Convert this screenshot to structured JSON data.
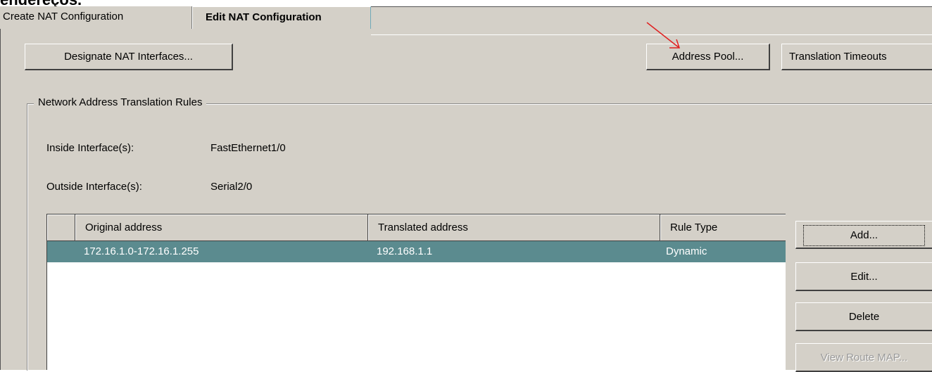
{
  "top_cut_text": "endereços.",
  "tabs": [
    {
      "label": "Create NAT Configuration",
      "active": false
    },
    {
      "label": "Edit NAT Configuration",
      "active": true
    }
  ],
  "toolbar": {
    "designate_label": "Designate NAT Interfaces...",
    "pool_label": "Address Pool...",
    "timeouts_label": "Translation Timeouts"
  },
  "rules_group": {
    "title": "Network Address Translation Rules",
    "inside_label": "Inside Interface(s):",
    "inside_value": "FastEthernet1/0",
    "outside_label": "Outside Interface(s):",
    "outside_value": "Serial2/0"
  },
  "table": {
    "columns": [
      "Original address",
      "Translated address",
      "Rule Type"
    ],
    "rows": [
      {
        "original": "172.16.1.0-172.16.1.255",
        "translated": "192.168.1.1",
        "type": "Dynamic",
        "selected": true
      }
    ]
  },
  "side_buttons": {
    "add": "Add...",
    "edit": "Edit...",
    "delete": "Delete",
    "route_map": "View Route MAP..."
  },
  "colors": {
    "panel_bg": "#d4d0c8",
    "selected_row": "#5b8b8f",
    "annotation_arrow": "#e02020"
  }
}
